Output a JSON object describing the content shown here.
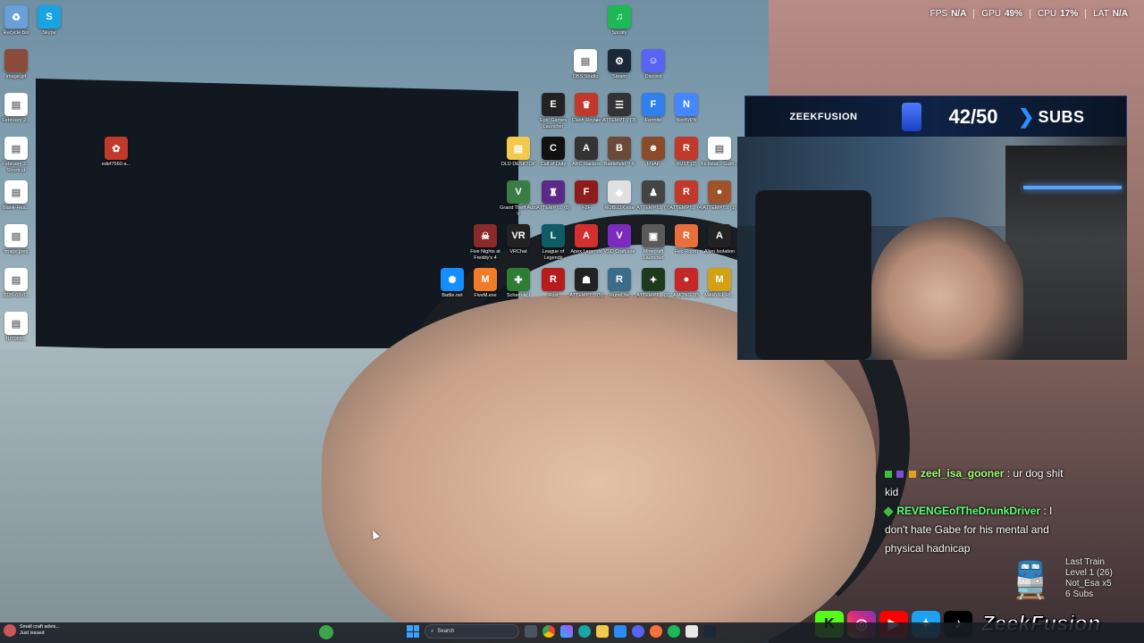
{
  "hud": [
    {
      "label": "FPS",
      "value": "N/A"
    },
    {
      "label": "GPU",
      "value": "49",
      "unit": "%"
    },
    {
      "label": "CPU",
      "value": "17",
      "unit": "%"
    },
    {
      "label": "LAT",
      "value": "N/A"
    }
  ],
  "subs": {
    "brand": "ZEEKFUSION",
    "count": "42/50",
    "label": "SUBS"
  },
  "chat": [
    {
      "user": "zeel_isa_gooner",
      "message": ": ur dog shit kid"
    },
    {
      "user": "REVENGEofTheDrunkDriver",
      "message": ": I don't hate Gabe for his mental and physical hadnicap"
    }
  ],
  "train": {
    "title": "Last Train",
    "level": "Level 1 (26)",
    "user": "Not_Esa x5",
    "subs": "6 Subs"
  },
  "social": {
    "brand": "ZeekFusion"
  },
  "taskbar": {
    "notification_title": "Small craft advis...",
    "notification_sub": "Just issued",
    "search_placeholder": "Search"
  },
  "desktop_icons": [
    {
      "label": "Recycle Bin",
      "color": "#6aa0d8",
      "glyph": "♻"
    },
    {
      "label": "Skype",
      "color": "#1aa3e3",
      "glyph": "S"
    },
    {
      "label": "image.gif",
      "color": "#8a4b3a",
      "glyph": ""
    },
    {
      "label": "February 2...",
      "color": "#ffffff",
      "glyph": ""
    },
    {
      "label": "February 2... Shortcut",
      "color": "#ffffff",
      "glyph": ""
    },
    {
      "label": "Blank-Hea...",
      "color": "#ffffff",
      "glyph": ""
    },
    {
      "label": "image.jpeg",
      "color": "#ffffff",
      "glyph": ""
    },
    {
      "label": "2026-02-0...",
      "color": "#ffffff",
      "glyph": ""
    },
    {
      "label": "f1f7986...",
      "color": "#ffffff",
      "glyph": ""
    },
    {
      "label": "edef7560-a...",
      "color": "#c0392b",
      "glyph": "✿"
    },
    {
      "label": "Spotify",
      "color": "#1db954",
      "glyph": "♫"
    },
    {
      "label": "OBS Studio",
      "color": "#ffffff",
      "glyph": ""
    },
    {
      "label": "Steam",
      "color": "#1b2838",
      "glyph": "⚙"
    },
    {
      "label": "Discord",
      "color": "#5865f2",
      "glyph": "☺"
    },
    {
      "label": "Epic Games Launcher",
      "color": "#222222",
      "glyph": "E"
    },
    {
      "label": "Clash Royale",
      "color": "#c0392b",
      "glyph": "♛"
    },
    {
      "label": "ATTEMPT... (3)",
      "color": "#333333",
      "glyph": "☰"
    },
    {
      "label": "Fortnite",
      "color": "#2f80ed",
      "glyph": "F"
    },
    {
      "label": "NordVPN",
      "color": "#4687ff",
      "glyph": "N"
    },
    {
      "label": "OLD DESKTOP",
      "color": "#f2c94c",
      "glyph": "▤"
    },
    {
      "label": "Call of Duty",
      "color": "#111111",
      "glyph": "C"
    },
    {
      "label": "ARC Raiders",
      "color": "#333333",
      "glyph": "A"
    },
    {
      "label": "Battlefield™ 6",
      "color": "#6b4a3a",
      "glyph": "B"
    },
    {
      "label": "FNAF",
      "color": "#8a4b2a",
      "glyph": "☻"
    },
    {
      "label": "RUST (2)",
      "color": "#c0392b",
      "glyph": "R"
    },
    {
      "label": "Kickstar... Gam...",
      "color": "#ffffff",
      "glyph": ""
    },
    {
      "label": "Grand Theft Auto V",
      "color": "#3a7d44",
      "glyph": "V"
    },
    {
      "label": "ATTEMPT... (8)",
      "color": "#5b2a86",
      "glyph": "♜"
    },
    {
      "label": "F2F",
      "color": "#8e1c1c",
      "glyph": "F"
    },
    {
      "label": "ROBLOX.exe",
      "color": "#e0e0e0",
      "glyph": "◆"
    },
    {
      "label": "ATTEMPT... (7)",
      "color": "#444444",
      "glyph": "♟"
    },
    {
      "label": "ATTEMPT... (4)",
      "color": "#c0392b",
      "glyph": "R"
    },
    {
      "label": "ATTEMPT... (1)",
      "color": "#a0522d",
      "glyph": "●"
    },
    {
      "label": "Five Nights at Freddy's 4",
      "color": "#8a2a2a",
      "glyph": "☠"
    },
    {
      "label": "VRChat",
      "color": "#222222",
      "glyph": "VR"
    },
    {
      "label": "League of Legends",
      "color": "#0f5b66",
      "glyph": "L"
    },
    {
      "label": "Apex Legends",
      "color": "#d32f2f",
      "glyph": "A"
    },
    {
      "label": "VSD Craft.exe",
      "color": "#7b2cbf",
      "glyph": "V"
    },
    {
      "label": "Minecraft Launcher",
      "color": "#5a5a5a",
      "glyph": "▣"
    },
    {
      "label": "Rec Room",
      "color": "#e86f3c",
      "glyph": "R"
    },
    {
      "label": "Alien Isolation",
      "color": "#222222",
      "glyph": "A"
    },
    {
      "label": "Battle.net",
      "color": "#148eff",
      "glyph": "✺"
    },
    {
      "label": "FiveM.exe",
      "color": "#f07c2a",
      "glyph": "M"
    },
    {
      "label": "Schedule I",
      "color": "#2e7d32",
      "glyph": "✚"
    },
    {
      "label": "Rust",
      "color": "#b71c1c",
      "glyph": "R"
    },
    {
      "label": "ATTEMPT... (5)",
      "color": "#222222",
      "glyph": "☗"
    },
    {
      "label": "RuneLite",
      "color": "#3b6d8a",
      "glyph": "R"
    },
    {
      "label": "ATTEMPT... (2)",
      "color": "#1d3a1d",
      "glyph": "✦"
    },
    {
      "label": "AMONG US",
      "color": "#c62828",
      "glyph": "●"
    },
    {
      "label": "MARVEL Ri...",
      "color": "#d4a017",
      "glyph": "M"
    }
  ]
}
